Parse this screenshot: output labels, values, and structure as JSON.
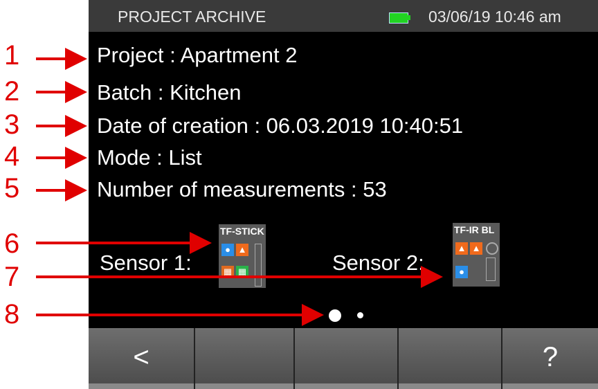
{
  "status_bar": {
    "title": "PROJECT ARCHIVE",
    "datetime": "03/06/19 10:46 am",
    "battery_color": "#22d322"
  },
  "info": {
    "project": "Project : Apartment 2",
    "batch": "Batch : Kitchen",
    "date": "Date of creation : 06.03.2019 10:40:51",
    "mode": "Mode : List",
    "measurements": "Number of measurements : 53"
  },
  "sensors": [
    {
      "label": "Sensor 1:",
      "name": "TF-STICK"
    },
    {
      "label": "Sensor 2:",
      "name": "TF-IR BL"
    }
  ],
  "pagination": {
    "pages": 2,
    "current": 1
  },
  "buttons": {
    "back": "<",
    "help": "?"
  },
  "callouts": [
    "1",
    "2",
    "3",
    "4",
    "5",
    "6",
    "7",
    "8"
  ],
  "colors": {
    "callout": "#e00000",
    "water": "#2a8ee8",
    "temp": "#f06a1c",
    "grid_orange": "#e06a20",
    "grid_green": "#2ab34a"
  }
}
